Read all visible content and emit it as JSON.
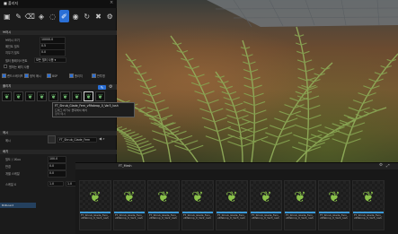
{
  "window": {
    "tab_label": "■ 폴리지"
  },
  "toolbar": {
    "icons": [
      "select-icon",
      "paint-icon",
      "erase-icon",
      "fill-icon",
      "lasso-icon",
      "brush-icon",
      "single-icon",
      "reapply-icon",
      "remove-icon",
      "settings-icon"
    ],
    "active_index": 5
  },
  "brush": {
    "section_title": "브러시",
    "rows": [
      {
        "label": "브러시 크기",
        "value": "10000.0"
      },
      {
        "label": "페인트 밀도",
        "value": "0.5"
      },
      {
        "label": "지우기 밀도",
        "value": "0.0"
      }
    ],
    "filter_label": "필터 플레이스먼트",
    "filter_value": "모든 필터 사용 ▾",
    "checkbox_label": "원하는 배치 사용"
  },
  "filters": {
    "labels": [
      "랜드스케이프",
      "정적 메시",
      "BSP",
      "폴리지",
      "반투명"
    ]
  },
  "foliage_list": {
    "title": "폴리지",
    "count": 9,
    "selected_index": 7
  },
  "tooltip": {
    "name": "FT_Shrub_Glade_Fern_vRfabrop_0_Var3_lush",
    "line2": "드래그 하거나 클릭해서 배치",
    "line3": "정적 메시"
  },
  "details": {
    "section_mesh": "메시",
    "mesh_label": "메시",
    "mesh_value": "FT_Shrub_Glade_Fern",
    "section_placement": "배치",
    "rows": [
      {
        "label": "밀도 / 1Kuu",
        "value": "100.0"
      },
      {
        "label": "반경",
        "value": "0.0"
      },
      {
        "label": "개별 스케일",
        "value": "0.0"
      }
    ],
    "scale_label": "스케일 X",
    "scale_min": "1.0",
    "scale_max": "1.0",
    "side_item": "Billboard"
  },
  "content_browser": {
    "header_left": "FT_Mesh",
    "assets": [
      {
        "name": "FT_Shrub_Glade_Fern_vRfabrop_0_Var1_lush"
      },
      {
        "name": "FT_Shrub_Glade_Fern_vRfabrop_0_Var1_lush"
      },
      {
        "name": "FT_Shrub_Glade_Fern_vRfabrop_0_Var2_lush"
      },
      {
        "name": "FT_Shrub_Glade_Fern_vRfabrop_0_Var2_lush"
      },
      {
        "name": "FT_Shrub_Glade_Fern_vRfabrop_0_Var3_lush"
      },
      {
        "name": "FT_Shrub_Glade_Fern_vRfabrop_0_Var3_lush"
      },
      {
        "name": "FT_Shrub_Glade_Fern_vRfabrop_0_Var4_lush"
      },
      {
        "name": "FT_Shrub_Glade_Fern_vRfabrop_0_Var4_lush"
      },
      {
        "name": "FT_Shrub_Glade_Fern_vRfabrop_0_Var5_lush"
      }
    ]
  },
  "colors": {
    "accent": "#2a6fd6",
    "panel": "#1b1b1b",
    "fern": "#7a9a4a",
    "soil": "#7a5533"
  }
}
